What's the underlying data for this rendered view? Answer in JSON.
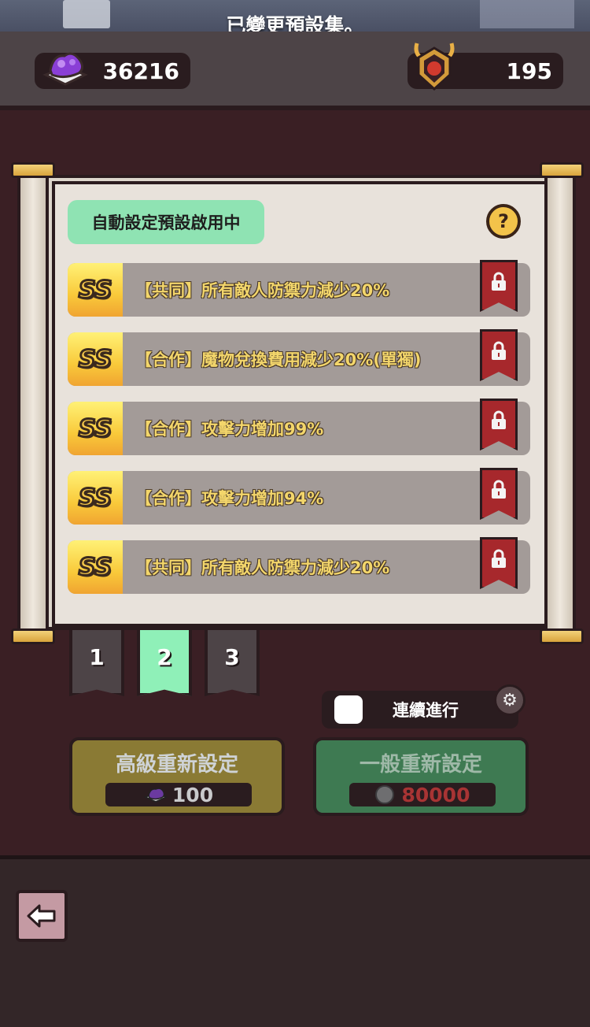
{
  "toast": "已變更預設集。",
  "resources": {
    "gems": "36216",
    "trophies": "195",
    "gem_icon": "purple-gem-icon",
    "trophy_icon": "horned-trophy-icon"
  },
  "panel": {
    "auto_preset_label": "自動設定預設啟用中",
    "help_icon": "?",
    "rows": [
      {
        "grade": "SS",
        "text": "【共同】所有敵人防禦力減少20%",
        "locked": true
      },
      {
        "grade": "SS",
        "text": "【合作】魔物兌換費用減少20%(單獨)",
        "locked": true
      },
      {
        "grade": "SS",
        "text": "【合作】攻擊力增加99%",
        "locked": true
      },
      {
        "grade": "SS",
        "text": "【合作】攻擊力增加94%",
        "locked": true
      },
      {
        "grade": "SS",
        "text": "【共同】所有敵人防禦力減少20%",
        "locked": true
      }
    ]
  },
  "tabs": [
    "1",
    "2",
    "3"
  ],
  "active_tab": "2",
  "continuous": {
    "label": "連續進行",
    "checked": false
  },
  "buttons": {
    "advanced": {
      "title": "高級重新設定",
      "cost": "100",
      "currency_icon": "purple-gem-icon"
    },
    "normal": {
      "title": "一般重新設定",
      "cost": "80000",
      "currency_icon": "coin-icon"
    }
  },
  "colors": {
    "accent_green": "#8fe3b3",
    "lock_red": "#a7282c",
    "grade_gold": "#f9c93a",
    "stat_text": "#f3d66b"
  }
}
